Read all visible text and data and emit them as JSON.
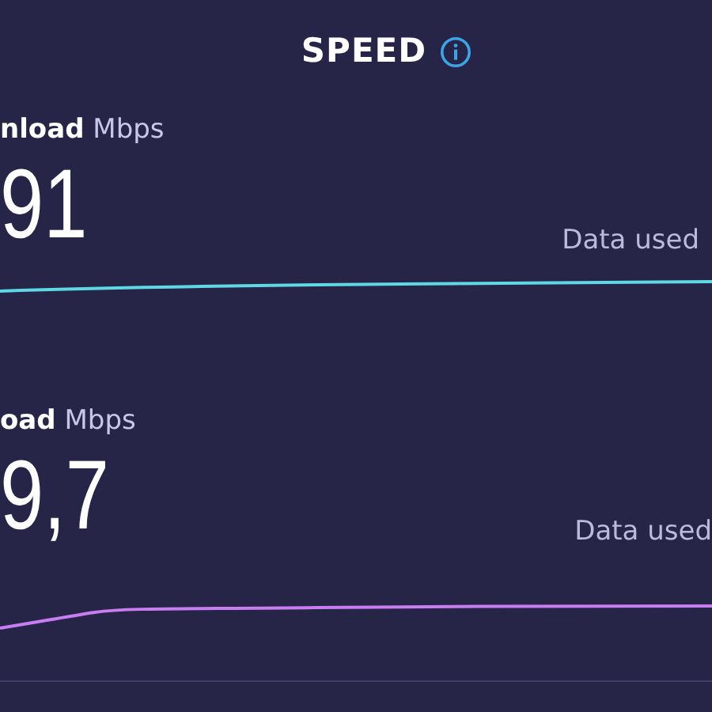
{
  "header": {
    "title": "SPEED"
  },
  "metrics": [
    {
      "label": "**nload** Mbps",
      "value": "91",
      "data_used": "Data used",
      "color": "#5fd8e6"
    },
    {
      "label": "**oad** Mbps",
      "value": "9,7",
      "data_used": "Data used",
      "color": "#c87ef0"
    }
  ]
}
